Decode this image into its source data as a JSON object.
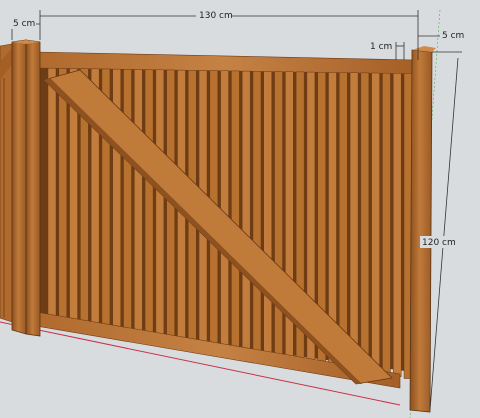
{
  "dimensions": {
    "post_left_width": "5 cm",
    "gate_width": "130 cm",
    "slat_gap": "1 cm",
    "post_right_width": "5 cm",
    "gate_height": "120 cm"
  },
  "colors": {
    "background": "#d9dcdf",
    "wood_light": "#c07a3a",
    "wood_mid": "#a9652c",
    "wood_dark": "#7a4418",
    "shadow": "#5a3414",
    "dimension_line": "#333333",
    "ground_line": "#c8324a"
  }
}
